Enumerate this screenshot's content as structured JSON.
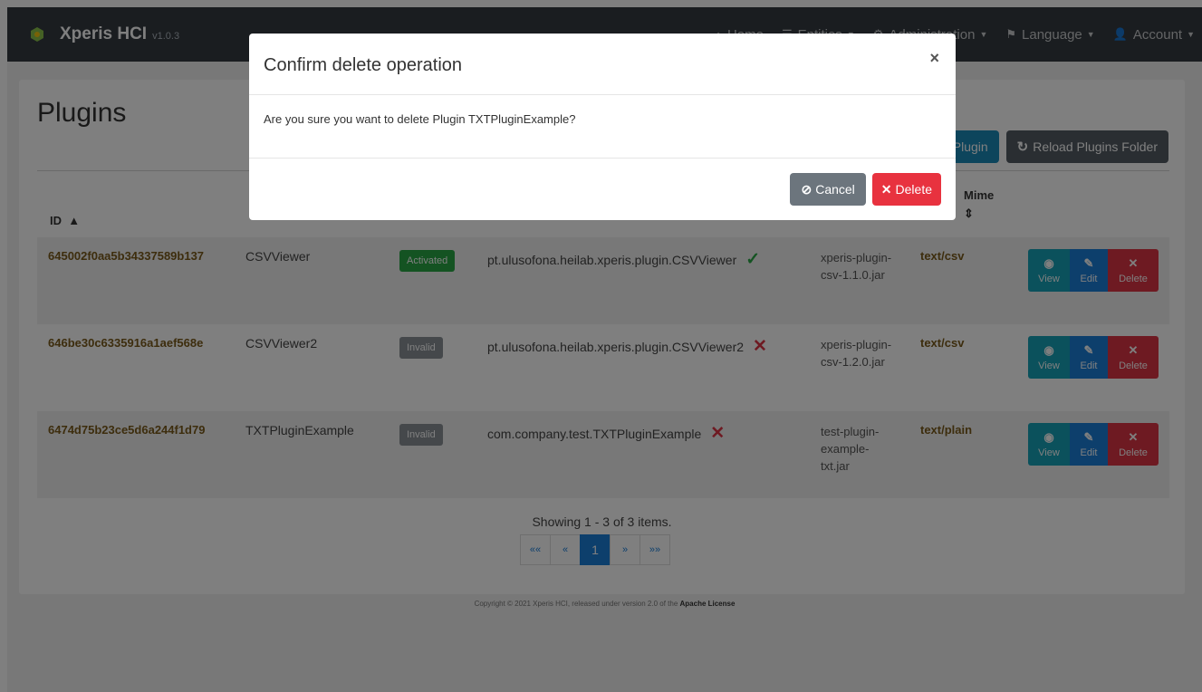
{
  "navbar": {
    "brand": "Xperis HCI",
    "version": "v1.0.3",
    "items": [
      {
        "icon": "home-icon",
        "glyph": "⌂",
        "label": "Home",
        "caret": false
      },
      {
        "icon": "list-icon",
        "glyph": "☰",
        "label": "Entities",
        "caret": true
      },
      {
        "icon": "user-plus-icon",
        "glyph": "⚙",
        "label": "Administration",
        "caret": true
      },
      {
        "icon": "flag-icon",
        "glyph": "⚑",
        "label": "Language",
        "caret": true
      },
      {
        "icon": "user-icon",
        "glyph": "👤",
        "label": "Account",
        "caret": true
      }
    ]
  },
  "page": {
    "title": "Plugins",
    "create_label": "Create a new Plugin",
    "reload_label": "Reload Plugins Folder"
  },
  "table": {
    "headers": {
      "id": "ID",
      "mime": "Mime"
    },
    "rows": [
      {
        "id": "645002f0aa5b34337589b137",
        "name": "CSVViewer",
        "status": "Activated",
        "valid": true,
        "class_name": "pt.ulusofona.heilab.xperis.plugin.CSVViewer",
        "jar": "xperis-plugin-csv-1.1.0.jar",
        "mime": "text/csv"
      },
      {
        "id": "646be30c6335916a1aef568e",
        "name": "CSVViewer2",
        "status": "Invalid",
        "valid": false,
        "class_name": "pt.ulusofona.heilab.xperis.plugin.CSVViewer2",
        "jar": "xperis-plugin-csv-1.2.0.jar",
        "mime": "text/csv"
      },
      {
        "id": "6474d75b23ce5d6a244f1d79",
        "name": "TXTPluginExample",
        "status": "Invalid",
        "valid": false,
        "class_name": "com.company.test.TXTPluginExample",
        "jar": "test-plugin-example-txt.jar",
        "mime": "text/plain"
      }
    ],
    "actions": {
      "view": "View",
      "edit": "Edit",
      "delete": "Delete"
    }
  },
  "pagination": {
    "info": "Showing 1 - 3 of 3 items.",
    "first": "««",
    "prev": "«",
    "current": "1",
    "next": "»",
    "last": "»»"
  },
  "footer": {
    "text": "Copyright © 2021 Xperis HCI, released under version 2.0 of the",
    "link": "Apache License"
  },
  "modal": {
    "title": "Confirm delete operation",
    "close": "×",
    "body": "Are you sure you want to delete Plugin TXTPluginExample?",
    "cancel_label": "Cancel",
    "delete_label": "Delete"
  },
  "colors": {
    "navbar": "#343a40",
    "activated": "#28a745",
    "invalid": "#8a9096",
    "danger": "#dc3545",
    "info": "#17a2b8",
    "primary": "#1b7fd9"
  }
}
